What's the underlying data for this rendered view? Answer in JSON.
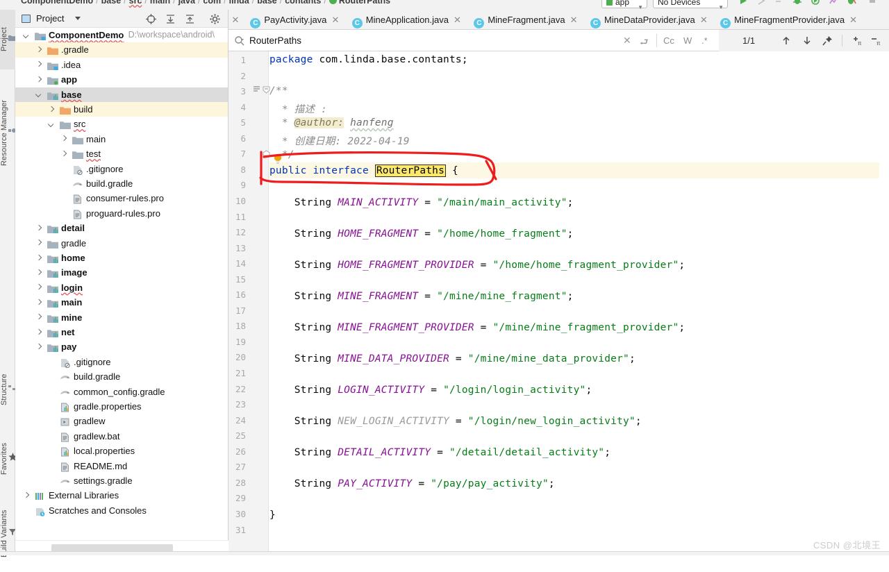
{
  "window": {
    "breadcrumb": [
      "ComponentDemo",
      "base",
      "src",
      "main",
      "java",
      "com",
      "linda",
      "base",
      "contants",
      "RouterPaths"
    ],
    "run_config": "app",
    "device_target": "No Devices",
    "watermark": "CSDN @北境王"
  },
  "left_strip": {
    "tabs": [
      {
        "label": "Project",
        "icon": "project-icon",
        "active": true
      },
      {
        "label": "Resource Manager",
        "icon": "resource-manager-icon",
        "active": false
      },
      {
        "label": "Structure",
        "icon": "structure-icon",
        "active": false
      },
      {
        "label": "Favorites",
        "icon": "star-icon",
        "active": false
      },
      {
        "label": "Build Variants",
        "icon": "build-variants-icon",
        "active": false
      }
    ]
  },
  "project_panel": {
    "title": "Project",
    "toolbar_icons": [
      "locate-icon",
      "expand-all-icon",
      "collapse-all-icon",
      "settings-gear-icon",
      "hide-icon"
    ],
    "tree": [
      {
        "label": "ComponentDemo",
        "path": "D:\\workspace\\android\\",
        "depth": 0,
        "arrow": "open",
        "icon": "module-icon",
        "bold": true,
        "wavy": true,
        "state": "normal"
      },
      {
        "label": ".gradle",
        "depth": 1,
        "arrow": "closed",
        "icon": "folder-orange-icon",
        "bold": false,
        "state": "highlight"
      },
      {
        "label": ".idea",
        "depth": 1,
        "arrow": "closed",
        "icon": "module-icon",
        "bold": false,
        "state": "normal"
      },
      {
        "label": "app",
        "depth": 1,
        "arrow": "closed",
        "icon": "module-green-icon",
        "bold": true,
        "state": "normal"
      },
      {
        "label": "base",
        "depth": 1,
        "arrow": "open",
        "icon": "module-bars-icon",
        "bold": true,
        "wavy": true,
        "state": "selected"
      },
      {
        "label": "build",
        "depth": 2,
        "arrow": "closed",
        "icon": "folder-orange-icon",
        "bold": false,
        "state": "highlight"
      },
      {
        "label": "src",
        "depth": 2,
        "arrow": "open",
        "icon": "folder-icon",
        "bold": false,
        "wavy": true,
        "state": "normal"
      },
      {
        "label": "main",
        "depth": 3,
        "arrow": "closed",
        "icon": "folder-icon",
        "bold": false,
        "state": "normal"
      },
      {
        "label": "test",
        "depth": 3,
        "arrow": "closed",
        "icon": "folder-icon",
        "bold": false,
        "wavy": true,
        "state": "normal"
      },
      {
        "label": ".gitignore",
        "depth": 3,
        "arrow": "none",
        "icon": "gitignore-file-icon",
        "bold": false,
        "state": "normal"
      },
      {
        "label": "build.gradle",
        "depth": 3,
        "arrow": "none",
        "icon": "gradle-file-icon",
        "bold": false,
        "state": "normal"
      },
      {
        "label": "consumer-rules.pro",
        "depth": 3,
        "arrow": "none",
        "icon": "text-file-icon",
        "bold": false,
        "state": "normal"
      },
      {
        "label": "proguard-rules.pro",
        "depth": 3,
        "arrow": "none",
        "icon": "text-file-icon",
        "bold": false,
        "state": "normal"
      },
      {
        "label": "detail",
        "depth": 1,
        "arrow": "closed",
        "icon": "module-bars-icon",
        "bold": true,
        "state": "normal"
      },
      {
        "label": "gradle",
        "depth": 1,
        "arrow": "closed",
        "icon": "folder-icon",
        "bold": false,
        "state": "normal"
      },
      {
        "label": "home",
        "depth": 1,
        "arrow": "closed",
        "icon": "module-bars-icon",
        "bold": true,
        "state": "normal"
      },
      {
        "label": "image",
        "depth": 1,
        "arrow": "closed",
        "icon": "module-bars-icon",
        "bold": true,
        "state": "normal"
      },
      {
        "label": "login",
        "depth": 1,
        "arrow": "closed",
        "icon": "module-bars-icon",
        "bold": true,
        "wavy": true,
        "state": "normal"
      },
      {
        "label": "main",
        "depth": 1,
        "arrow": "closed",
        "icon": "module-bars-icon",
        "bold": true,
        "state": "normal"
      },
      {
        "label": "mine",
        "depth": 1,
        "arrow": "closed",
        "icon": "module-bars-icon",
        "bold": true,
        "state": "normal"
      },
      {
        "label": "net",
        "depth": 1,
        "arrow": "closed",
        "icon": "module-bars-icon",
        "bold": true,
        "state": "normal"
      },
      {
        "label": "pay",
        "depth": 1,
        "arrow": "closed",
        "icon": "module-bars-icon",
        "bold": true,
        "state": "normal"
      },
      {
        "label": ".gitignore",
        "depth": 2,
        "arrow": "none",
        "icon": "gitignore-file-icon",
        "bold": false,
        "state": "normal"
      },
      {
        "label": "build.gradle",
        "depth": 2,
        "arrow": "none",
        "icon": "gradle-file-icon",
        "bold": false,
        "state": "normal"
      },
      {
        "label": "common_config.gradle",
        "depth": 2,
        "arrow": "none",
        "icon": "gradle-file-icon",
        "bold": false,
        "state": "normal"
      },
      {
        "label": "gradle.properties",
        "depth": 2,
        "arrow": "none",
        "icon": "properties-file-icon",
        "bold": false,
        "state": "normal"
      },
      {
        "label": "gradlew",
        "depth": 2,
        "arrow": "none",
        "icon": "script-file-icon",
        "bold": false,
        "state": "normal"
      },
      {
        "label": "gradlew.bat",
        "depth": 2,
        "arrow": "none",
        "icon": "text-file-icon",
        "bold": false,
        "state": "normal"
      },
      {
        "label": "local.properties",
        "depth": 2,
        "arrow": "none",
        "icon": "properties-file-icon",
        "bold": false,
        "state": "normal"
      },
      {
        "label": "README.md",
        "depth": 2,
        "arrow": "none",
        "icon": "text-file-icon",
        "bold": false,
        "state": "normal"
      },
      {
        "label": "settings.gradle",
        "depth": 2,
        "arrow": "none",
        "icon": "gradle-file-icon",
        "bold": false,
        "state": "normal"
      },
      {
        "label": "External Libraries",
        "depth": 0,
        "arrow": "closed",
        "icon": "external-libraries-icon",
        "bold": false,
        "state": "normal"
      },
      {
        "label": "Scratches and Consoles",
        "depth": 0,
        "arrow": "none",
        "icon": "scratches-icon",
        "bold": false,
        "state": "normal"
      }
    ]
  },
  "editor": {
    "tabs": [
      {
        "label": "PayActivity.java",
        "active": false
      },
      {
        "label": "MineApplication.java",
        "active": false
      },
      {
        "label": "MineFragment.java",
        "active": false
      },
      {
        "label": "MineDataProvider.java",
        "active": false
      },
      {
        "label": "MineFragmentProvider.java",
        "active": false
      }
    ],
    "find_bar": {
      "query": "RouterPaths",
      "match_count": "1/1",
      "options": [
        "Cc",
        "W",
        ".*"
      ],
      "icons": [
        "search-icon",
        "clear-icon",
        "replace-toggle-icon",
        "prev-match-icon",
        "next-match-icon",
        "pin-icon",
        "add-selection-icon",
        "remove-selection-icon",
        "select-all-icon",
        "open-in-find-window-icon",
        "filter-icon"
      ]
    },
    "first_line": 1,
    "last_line": 31,
    "highlight_line": 8,
    "code_lines": [
      {
        "n": 1,
        "text": "package com.linda.base.contants;"
      },
      {
        "n": 2,
        "text": ""
      },
      {
        "n": 3,
        "text": "/**"
      },
      {
        "n": 4,
        "text": " * 描述 :"
      },
      {
        "n": 5,
        "text": " * @author: hanfeng"
      },
      {
        "n": 6,
        "text": " * 创建日期: 2022-04-19"
      },
      {
        "n": 7,
        "text": " */"
      },
      {
        "n": 8,
        "text": "public interface RouterPaths {"
      },
      {
        "n": 9,
        "text": ""
      },
      {
        "n": 10,
        "text": "    String MAIN_ACTIVITY = \"/main/main_activity\";"
      },
      {
        "n": 11,
        "text": ""
      },
      {
        "n": 12,
        "text": "    String HOME_FRAGMENT = \"/home/home_fragment\";"
      },
      {
        "n": 13,
        "text": ""
      },
      {
        "n": 14,
        "text": "    String HOME_FRAGMENT_PROVIDER = \"/home/home_fragment_provider\";"
      },
      {
        "n": 15,
        "text": ""
      },
      {
        "n": 16,
        "text": "    String MINE_FRAGMENT = \"/mine/mine_fragment\";"
      },
      {
        "n": 17,
        "text": ""
      },
      {
        "n": 18,
        "text": "    String MINE_FRAGMENT_PROVIDER = \"/mine/mine_fragment_provider\";"
      },
      {
        "n": 19,
        "text": ""
      },
      {
        "n": 20,
        "text": "    String MINE_DATA_PROVIDER = \"/mine/mine_data_provider\";"
      },
      {
        "n": 21,
        "text": ""
      },
      {
        "n": 22,
        "text": "    String LOGIN_ACTIVITY = \"/login/login_activity\";"
      },
      {
        "n": 23,
        "text": ""
      },
      {
        "n": 24,
        "text": "    String NEW_LOGIN_ACTIVITY = \"/login/new_login_activity\";"
      },
      {
        "n": 25,
        "text": ""
      },
      {
        "n": 26,
        "text": "    String DETAIL_ACTIVITY = \"/detail/detail_activity\";"
      },
      {
        "n": 27,
        "text": ""
      },
      {
        "n": 28,
        "text": "    String PAY_ACTIVITY = \"/pay/pay_activity\";"
      },
      {
        "n": 29,
        "text": ""
      },
      {
        "n": 30,
        "text": "}"
      },
      {
        "n": 31,
        "text": ""
      }
    ]
  },
  "colors": {
    "keyword": "#0033b3",
    "string": "#077d17",
    "field": "#871094",
    "comment": "#8c8c8c",
    "search_hit": "#fbe86d",
    "annotation": "#ee1c1c",
    "selection": "#dcdcdc",
    "highlight_row": "#fcf8e4"
  }
}
